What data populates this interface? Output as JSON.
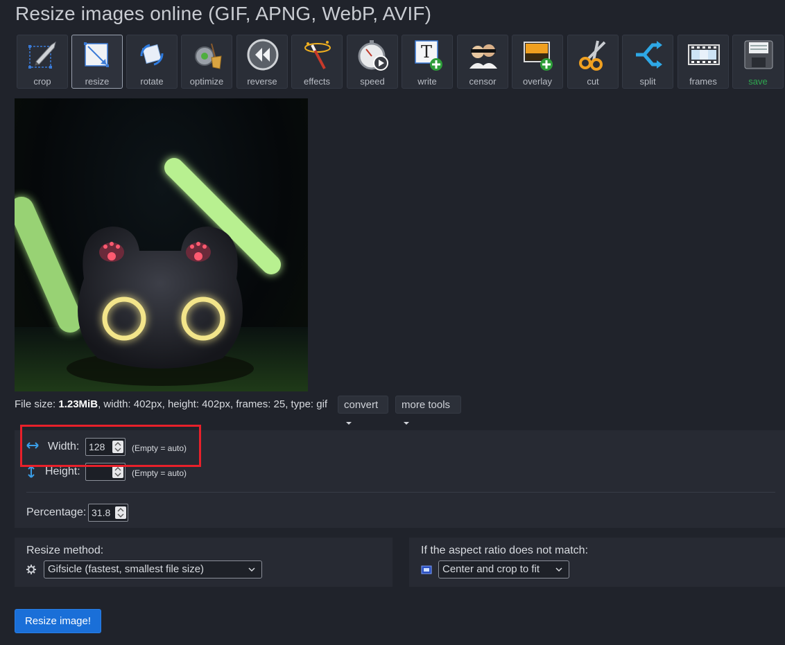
{
  "page": {
    "title": "Resize images online (GIF, APNG, WebP, AVIF)"
  },
  "toolbar": {
    "items": [
      {
        "label": "crop",
        "icon": "crop-icon"
      },
      {
        "label": "resize",
        "icon": "resize-icon",
        "active": true
      },
      {
        "label": "rotate",
        "icon": "rotate-icon"
      },
      {
        "label": "optimize",
        "icon": "optimize-icon"
      },
      {
        "label": "reverse",
        "icon": "reverse-icon"
      },
      {
        "label": "effects",
        "icon": "effects-wand-icon"
      },
      {
        "label": "speed",
        "icon": "stopwatch-icon"
      },
      {
        "label": "write",
        "icon": "write-text-icon"
      },
      {
        "label": "censor",
        "icon": "censor-icon"
      },
      {
        "label": "overlay",
        "icon": "overlay-image-icon"
      },
      {
        "label": "cut",
        "icon": "scissors-icon"
      },
      {
        "label": "split",
        "icon": "split-icon"
      },
      {
        "label": "frames",
        "icon": "film-frames-icon"
      },
      {
        "label": "save",
        "icon": "floppy-save-icon"
      }
    ]
  },
  "file_info": {
    "prefix": "File size: ",
    "size": "1.23MiB",
    "rest": ", width: 402px, height: 402px, frames: 25, type: gif",
    "convert_label": "convert",
    "more_tools_label": "more tools"
  },
  "resize_form": {
    "width_label": "Width:",
    "width_value": "128",
    "width_hint": "(Empty = auto)",
    "height_label": "Height:",
    "height_value": "",
    "height_hint": "(Empty = auto)",
    "percentage_label": "Percentage:",
    "percentage_value": "31.8",
    "highlight_color": "#e8202a"
  },
  "method": {
    "label": "Resize method:",
    "selected": "Gifsicle (fastest, smallest file size)",
    "icon": "gear-icon"
  },
  "aspect": {
    "label": "If the aspect ratio does not match:",
    "selected": "Center and crop to fit",
    "icon": "crop-fit-icon"
  },
  "submit": {
    "label": "Resize image!"
  },
  "colors": {
    "background": "#20232b",
    "accent": "#1a6fd8",
    "save_green": "#2fa84f"
  }
}
